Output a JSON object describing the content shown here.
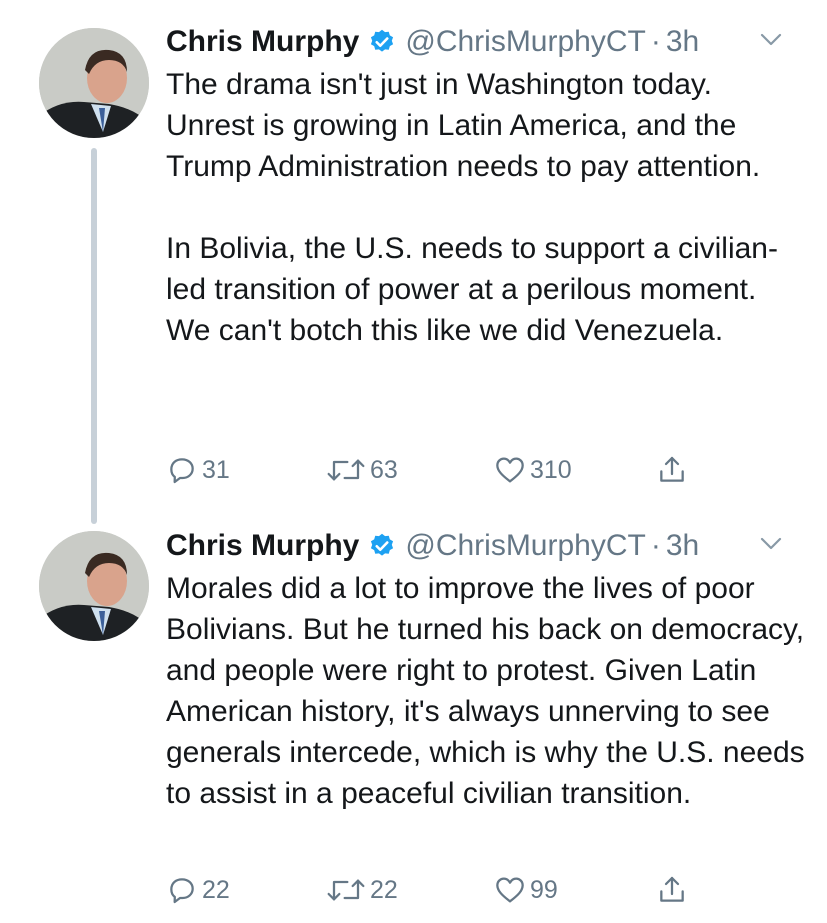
{
  "tweets": [
    {
      "author": {
        "name": "Chris Murphy",
        "handle": "@ChrisMurphyCT",
        "verified": true
      },
      "separator": "·",
      "time": "3h",
      "text": "The drama isn't just in Washington today. Unrest is growing in Latin America, and the Trump Administration needs to pay attention.\n\nIn Bolivia, the U.S. needs to support a civilian-led transition of power at a perilous moment. We can't botch this like we did Venezuela.",
      "replies": "31",
      "retweets": "63",
      "likes": "310"
    },
    {
      "author": {
        "name": "Chris Murphy",
        "handle": "@ChrisMurphyCT",
        "verified": true
      },
      "separator": "·",
      "time": "3h",
      "text": "Morales did a lot to improve the lives of poor Bolivians. But he turned his back on democracy, and people were right to protest. Given Latin American history, it's always unnerving to see generals intercede, which is why the U.S. needs to assist in a peaceful civilian transition.",
      "replies": "22",
      "retweets": "22",
      "likes": "99"
    }
  ],
  "colors": {
    "text": "#14171a",
    "secondary": "#657786",
    "verified": "#1da1f2",
    "thread_line": "#c7d0d8"
  },
  "icons": [
    "verified-badge-icon",
    "chevron-down-icon",
    "reply-icon",
    "retweet-icon",
    "like-icon",
    "share-icon"
  ]
}
